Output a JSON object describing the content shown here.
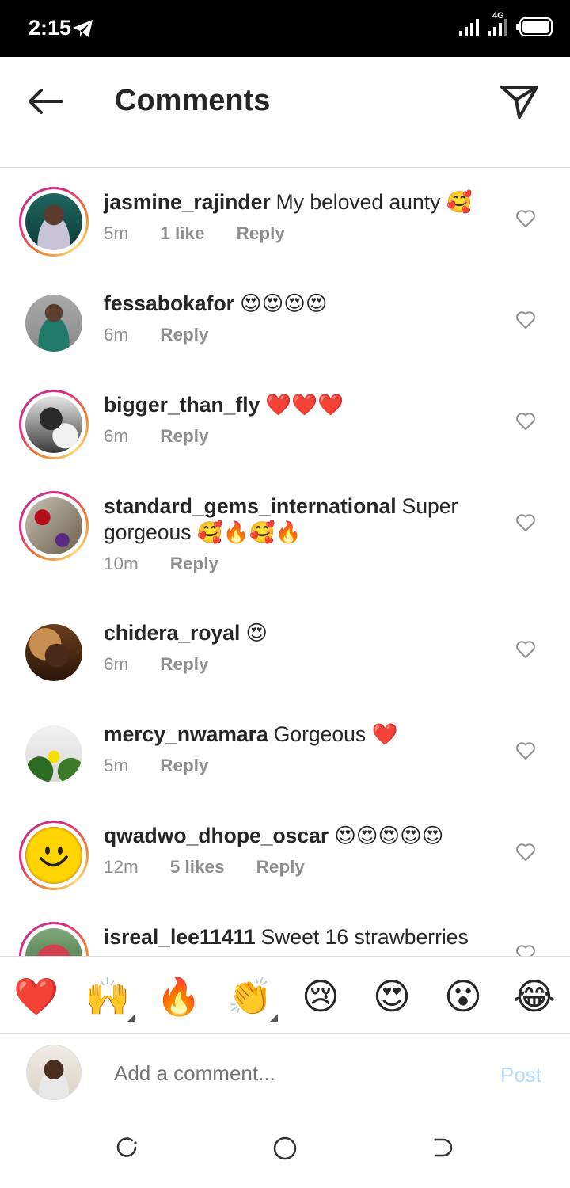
{
  "status_bar": {
    "time": "2:15",
    "network": "4G"
  },
  "header": {
    "title": "Comments"
  },
  "comments": [
    {
      "username": "jasmine_rajinder",
      "text": "My beloved aunty 🥰",
      "time": "5m",
      "likes": "1 like",
      "reply": "Reply",
      "story_ring": true
    },
    {
      "username": "fessabokafor",
      "text": "😍😍😍😍",
      "time": "6m",
      "likes": "",
      "reply": "Reply",
      "story_ring": false
    },
    {
      "username": "bigger_than_fly",
      "text": "❤️❤️❤️",
      "time": "6m",
      "likes": "",
      "reply": "Reply",
      "story_ring": true
    },
    {
      "username": "standard_gems_international",
      "text": "Super gorgeous 🥰🔥🥰🔥",
      "time": "10m",
      "likes": "",
      "reply": "Reply",
      "story_ring": true
    },
    {
      "username": "chidera_royal",
      "text": "😍",
      "time": "6m",
      "likes": "",
      "reply": "Reply",
      "story_ring": false
    },
    {
      "username": "mercy_nwamara",
      "text": "Gorgeous ❤️",
      "time": "5m",
      "likes": "",
      "reply": "Reply",
      "story_ring": false
    },
    {
      "username": "qwadwo_dhope_oscar",
      "text": "😍😍😍😍😍",
      "time": "12m",
      "likes": "5 likes",
      "reply": "Reply",
      "story_ring": true
    },
    {
      "username": "isreal_lee11411",
      "text": "Sweet 16 strawberries",
      "time": "",
      "likes": "",
      "reply": "",
      "story_ring": true
    }
  ],
  "reactions": [
    "❤️",
    "🙌",
    "🔥",
    "👏",
    "😢",
    "😍",
    "😮",
    "😂"
  ],
  "composer": {
    "placeholder": "Add a comment...",
    "post_label": "Post"
  }
}
